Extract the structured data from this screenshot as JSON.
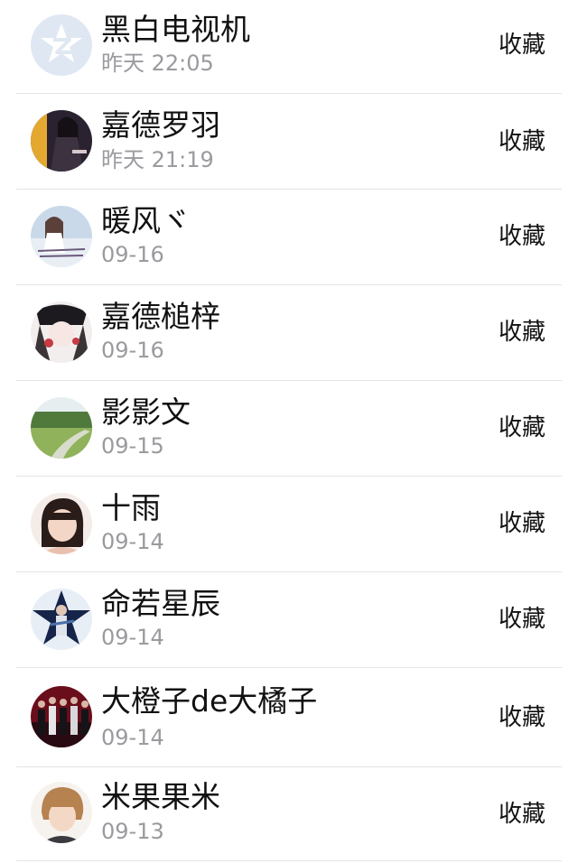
{
  "contacts": [
    {
      "name": "黑白电视机",
      "time": "昨天 22:05",
      "action": "收藏",
      "avatar": "qzone-logo-icon"
    },
    {
      "name": "嘉德罗羽",
      "time": "昨天 21:19",
      "action": "收藏",
      "avatar": "girl-dark-photo"
    },
    {
      "name": "暖风ヾ",
      "time": "09-16",
      "action": "收藏",
      "avatar": "girl-beach-photo"
    },
    {
      "name": "嘉德槌梓",
      "time": "09-16",
      "action": "收藏",
      "avatar": "anime-girl-photo"
    },
    {
      "name": "影影文",
      "time": "09-15",
      "action": "收藏",
      "avatar": "grass-road-photo"
    },
    {
      "name": "十雨",
      "time": "09-14",
      "action": "收藏",
      "avatar": "child-portrait-photo"
    },
    {
      "name": "命若星辰",
      "time": "09-14",
      "action": "收藏",
      "avatar": "performer-star-photo"
    },
    {
      "name": "大橙子de大橘子",
      "time": "09-14",
      "action": "收藏",
      "avatar": "group-stage-photo"
    },
    {
      "name": "米果果米",
      "time": "09-13",
      "action": "收藏",
      "avatar": "boy-portrait-photo"
    }
  ]
}
